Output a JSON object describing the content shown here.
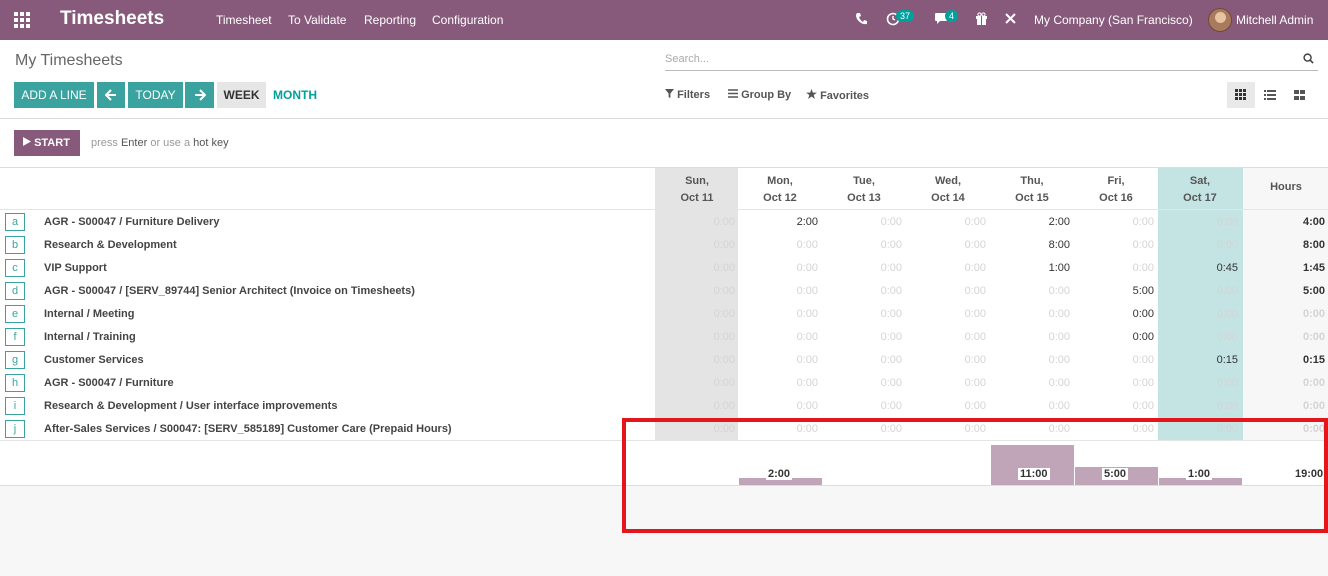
{
  "navbar": {
    "app_title": "Timesheets",
    "menu": [
      "Timesheet",
      "To Validate",
      "Reporting",
      "Configuration"
    ],
    "activity_count": "37",
    "message_count": "4",
    "company": "My Company (San Francisco)",
    "user": "Mitchell Admin"
  },
  "control": {
    "title": "My Timesheets",
    "search_placeholder": "Search...",
    "add_line": "ADD A LINE",
    "today": "TODAY",
    "week": "WEEK",
    "month": "MONTH",
    "filters": "Filters",
    "group_by": "Group By",
    "favorites": "Favorites"
  },
  "start": {
    "label": "START",
    "hint_press": "press",
    "hint_enter": "Enter",
    "hint_or": "or use a",
    "hint_hotkey": "hot key"
  },
  "grid": {
    "days": [
      {
        "dow": "Sun,",
        "date": "Oct 11"
      },
      {
        "dow": "Mon,",
        "date": "Oct 12"
      },
      {
        "dow": "Tue,",
        "date": "Oct 13"
      },
      {
        "dow": "Wed,",
        "date": "Oct 14"
      },
      {
        "dow": "Thu,",
        "date": "Oct 15"
      },
      {
        "dow": "Fri,",
        "date": "Oct 16"
      },
      {
        "dow": "Sat,",
        "date": "Oct 17"
      }
    ],
    "hours_header": "Hours",
    "rows": [
      {
        "key": "a",
        "name": "AGR - S00047  /  Furniture Delivery",
        "values": [
          "0:00",
          "2:00",
          "0:00",
          "0:00",
          "2:00",
          "0:00",
          "0:00"
        ],
        "total": "4:00"
      },
      {
        "key": "b",
        "name": "Research & Development",
        "values": [
          "0:00",
          "0:00",
          "0:00",
          "0:00",
          "8:00",
          "0:00",
          "0:00"
        ],
        "total": "8:00"
      },
      {
        "key": "c",
        "name": "VIP Support",
        "values": [
          "0:00",
          "0:00",
          "0:00",
          "0:00",
          "1:00",
          "0:00",
          "0:45"
        ],
        "total": "1:45"
      },
      {
        "key": "d",
        "name": "AGR - S00047  /  [SERV_89744] Senior Architect (Invoice on Timesheets)",
        "values": [
          "0:00",
          "0:00",
          "0:00",
          "0:00",
          "0:00",
          "5:00",
          "0:00"
        ],
        "total": "5:00"
      },
      {
        "key": "e",
        "name": "Internal  /  Meeting",
        "values": [
          "0:00",
          "0:00",
          "0:00",
          "0:00",
          "0:00",
          "0:00",
          "0:00"
        ],
        "total": "0:00"
      },
      {
        "key": "f",
        "name": "Internal  /  Training",
        "values": [
          "0:00",
          "0:00",
          "0:00",
          "0:00",
          "0:00",
          "0:00",
          "0:00"
        ],
        "total": "0:00"
      },
      {
        "key": "g",
        "name": "Customer Services",
        "values": [
          "0:00",
          "0:00",
          "0:00",
          "0:00",
          "0:00",
          "0:00",
          "0:15"
        ],
        "total": "0:15"
      },
      {
        "key": "h",
        "name": "AGR - S00047  /  Furniture",
        "values": [
          "0:00",
          "0:00",
          "0:00",
          "0:00",
          "0:00",
          "0:00",
          "0:00"
        ],
        "total": "0:00"
      },
      {
        "key": "i",
        "name": "Research & Development  /  User interface improvements",
        "values": [
          "0:00",
          "0:00",
          "0:00",
          "0:00",
          "0:00",
          "0:00",
          "0:00"
        ],
        "total": "0:00"
      },
      {
        "key": "j",
        "name": "After-Sales Services  /  S00047: [SERV_585189] Customer Care (Prepaid Hours)",
        "values": [
          "0:00",
          "0:00",
          "0:00",
          "0:00",
          "0:00",
          "0:00",
          "0:00"
        ],
        "total": "0:00"
      }
    ],
    "nonzero_flags": [
      [
        0,
        1,
        0,
        0,
        1,
        0,
        0
      ],
      [
        0,
        0,
        0,
        0,
        1,
        0,
        0
      ],
      [
        0,
        0,
        0,
        0,
        1,
        0,
        1
      ],
      [
        0,
        0,
        0,
        0,
        0,
        1,
        0
      ],
      [
        0,
        0,
        0,
        0,
        0,
        1,
        0
      ],
      [
        0,
        0,
        0,
        0,
        0,
        1,
        0
      ],
      [
        0,
        0,
        0,
        0,
        0,
        0,
        1
      ],
      [
        0,
        0,
        0,
        0,
        0,
        0,
        0
      ],
      [
        0,
        0,
        0,
        0,
        0,
        0,
        0
      ],
      [
        0,
        0,
        0,
        0,
        0,
        0,
        0
      ]
    ],
    "total_flags": [
      1,
      1,
      1,
      1,
      0,
      0,
      1,
      0,
      0,
      0
    ],
    "day_totals": [
      "",
      "2:00",
      "",
      "",
      "11:00",
      "5:00",
      "1:00"
    ],
    "day_total_hours": [
      0,
      2,
      0,
      0,
      11,
      5,
      1
    ],
    "grand_total": "19:00"
  },
  "colors": {
    "brand": "#875a7b",
    "teal": "#00a09d",
    "bar": "#bfa5b7",
    "highlight": "#e3161b"
  }
}
